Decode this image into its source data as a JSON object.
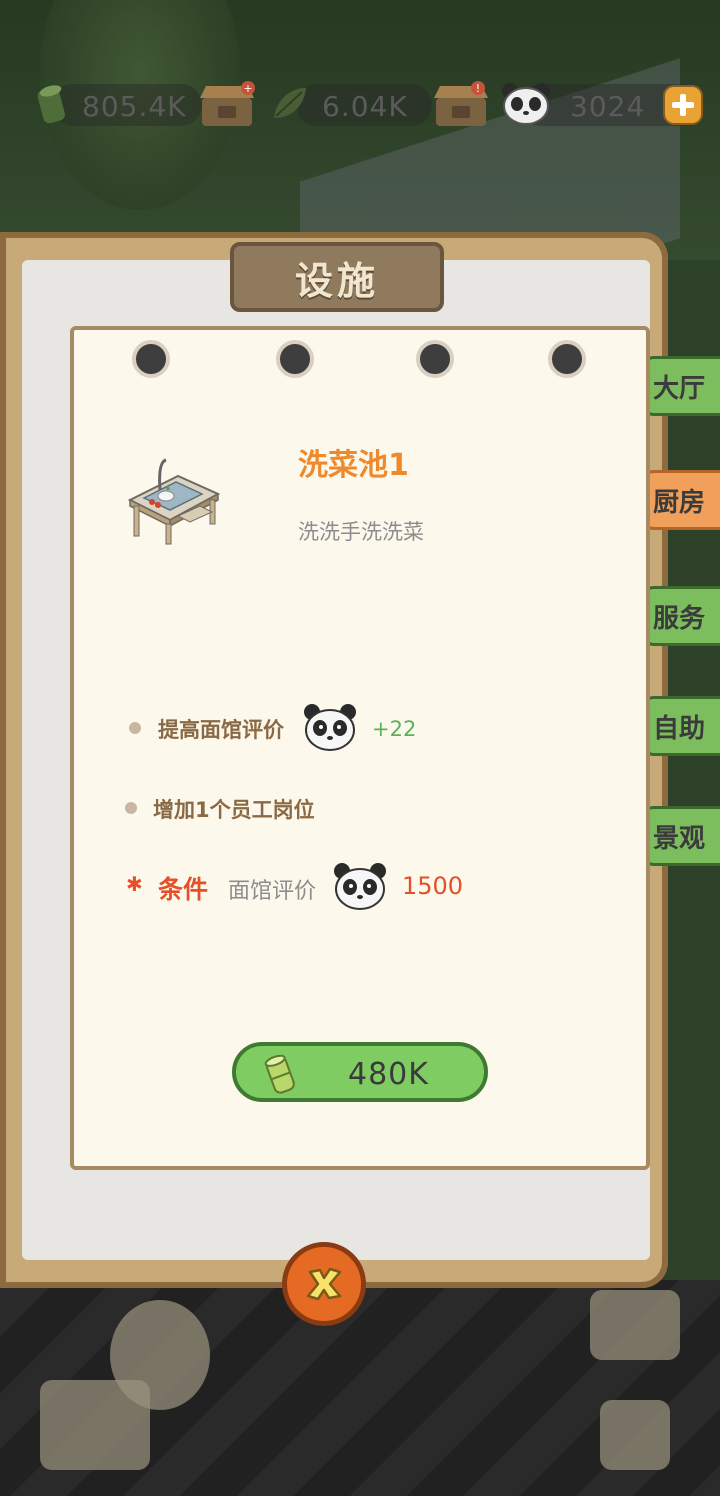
{
  "colors": {
    "accent_orange": "#ee8a2c",
    "condition_red": "#e3502a",
    "bonus_green": "#5bb05a",
    "button_green": "#7fcc63",
    "board_wood": "#c8a978",
    "card_bg": "#fdf8ec"
  },
  "resources": {
    "bamboo": {
      "icon": "bamboo-icon",
      "value": "805.4K"
    },
    "leaf": {
      "icon": "leaf-icon",
      "value": "6.04K"
    },
    "panda": {
      "icon": "panda-icon",
      "value": "3024"
    }
  },
  "dialog": {
    "title": "设施",
    "tabs": [
      {
        "label": "大厅",
        "active": false
      },
      {
        "label": "厨房",
        "active": true
      },
      {
        "label": "服务",
        "active": false
      },
      {
        "label": "自助",
        "active": false
      },
      {
        "label": "景观",
        "active": false
      }
    ],
    "item": {
      "name": "洗菜池1",
      "description": "洗洗手洗洗菜",
      "image_icon": "sink-table-icon"
    },
    "benefits": [
      {
        "text": "提高面馆评价",
        "bonus": "+22"
      },
      {
        "text": "增加1个员工岗位"
      }
    ],
    "condition": {
      "label": "条件",
      "text": "面馆评价",
      "value": "1500"
    },
    "buy_button": {
      "price": "480K",
      "icon": "bamboo-icon"
    },
    "close_icon": "close-icon"
  }
}
